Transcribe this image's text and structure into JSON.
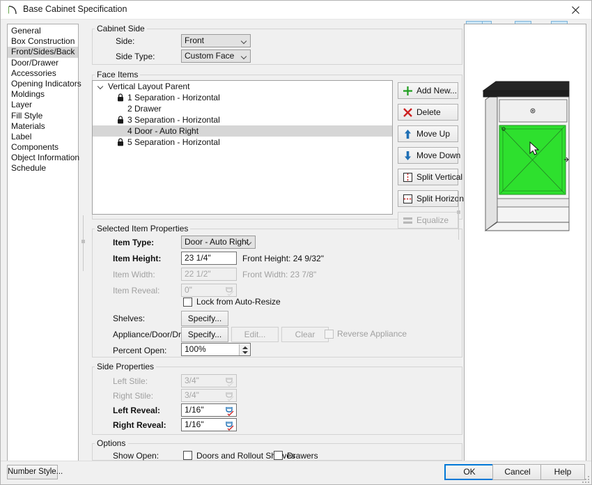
{
  "window": {
    "title": "Base Cabinet Specification",
    "app_icon": "chief-architect-arc-icon",
    "close_label": "✕"
  },
  "categories": {
    "selected": "Front/Sides/Back",
    "items": [
      "General",
      "Box Construction",
      "Front/Sides/Back",
      "Door/Drawer",
      "Accessories",
      "Opening Indicators",
      "Moldings",
      "Layer",
      "Fill Style",
      "Materials",
      "Label",
      "Components",
      "Object Information",
      "Schedule"
    ]
  },
  "cabinet_side": {
    "group_label": "Cabinet Side",
    "side_label": "Side:",
    "side_value": "Front",
    "side_type_label": "Side Type:",
    "side_type_value": "Custom Face"
  },
  "face_items": {
    "group_label": "Face Items",
    "tree": [
      {
        "label": "Vertical Layout Parent",
        "indent": 0,
        "lock": false,
        "twisty": true,
        "selected": false
      },
      {
        "label": "1 Separation - Horizontal",
        "indent": 1,
        "lock": true,
        "twisty": false,
        "selected": false
      },
      {
        "label": "2 Drawer",
        "indent": 1,
        "lock": false,
        "twisty": false,
        "selected": false
      },
      {
        "label": "3 Separation - Horizontal",
        "indent": 1,
        "lock": true,
        "twisty": false,
        "selected": false
      },
      {
        "label": "4 Door - Auto Right",
        "indent": 1,
        "lock": false,
        "twisty": false,
        "selected": true
      },
      {
        "label": "5 Separation - Horizontal",
        "indent": 1,
        "lock": true,
        "twisty": false,
        "selected": false
      }
    ],
    "buttons": [
      {
        "label": "Add New...",
        "icon": "plus-icon",
        "disabled": false
      },
      {
        "label": "Delete",
        "icon": "x-icon",
        "disabled": false
      },
      {
        "label": "Move Up",
        "icon": "arrow-up-icon",
        "disabled": false
      },
      {
        "label": "Move Down",
        "icon": "arrow-down-icon",
        "disabled": false
      },
      {
        "label": "Split Vertical",
        "icon": "split-vertical-icon",
        "disabled": false
      },
      {
        "label": "Split Horizontal",
        "icon": "split-horizontal-icon",
        "disabled": false
      },
      {
        "label": "Equalize",
        "icon": "equalize-icon",
        "disabled": true
      }
    ]
  },
  "selected_item": {
    "group_label": "Selected Item Properties",
    "item_type_label": "Item Type:",
    "item_type_value": "Door - Auto Right",
    "item_height_label": "Item Height:",
    "item_height_value": "23 1/4\"",
    "front_height_label": "Front Height:  24 9/32\"",
    "item_width_label": "Item Width:",
    "item_width_value": "22 1/2\"",
    "front_width_label": "Front Width:  23 7/8\"",
    "item_reveal_label": "Item Reveal:",
    "item_reveal_value": "0\"",
    "lock_auto_resize_label": "Lock from Auto-Resize",
    "lock_auto_resize_checked": false,
    "shelves_label": "Shelves:",
    "shelves_button": "Specify...",
    "appliance_label": "Appliance/Door/Drawer:",
    "appliance_specify_button": "Specify...",
    "appliance_edit_button": "Edit...",
    "appliance_clear_button": "Clear",
    "reverse_appliance_label": "Reverse Appliance",
    "reverse_appliance_checked": false,
    "percent_open_label": "Percent Open:",
    "percent_open_value": "100%"
  },
  "side_properties": {
    "group_label": "Side Properties",
    "left_stile_label": "Left Stile:",
    "left_stile_value": "3/4\"",
    "right_stile_label": "Right Stile:",
    "right_stile_value": "3/4\"",
    "left_reveal_label": "Left Reveal:",
    "left_reveal_value": "1/16\"",
    "right_reveal_label": "Right Reveal:",
    "right_reveal_value": "1/16\""
  },
  "options": {
    "group_label": "Options",
    "show_open_label": "Show Open:",
    "doors_label": "Doors and Rollout Shelves",
    "doors_checked": false,
    "drawers_label": "Drawers",
    "drawers_checked": false
  },
  "preview": {
    "toolbar": [
      {
        "name": "view-type-icon",
        "active": true,
        "caret": true
      },
      {
        "name": "fill-window-icon",
        "active": false,
        "caret": false
      },
      {
        "name": "color-on-off-icon",
        "active": true,
        "caret": false
      },
      {
        "name": "orbit-camera-icon",
        "active": false,
        "caret": false
      },
      {
        "name": "glass-house-icon",
        "active": true,
        "caret": false
      },
      {
        "name": "rotate-view-icon",
        "active": false,
        "caret": false
      }
    ],
    "selection_color": "#2ee02e",
    "countertop_color": "#262626",
    "cabinet_color": "#f2f2f2"
  },
  "footer": {
    "number_style_button": "Number Style...",
    "ok_button": "OK",
    "cancel_button": "Cancel",
    "help_button": "Help"
  }
}
